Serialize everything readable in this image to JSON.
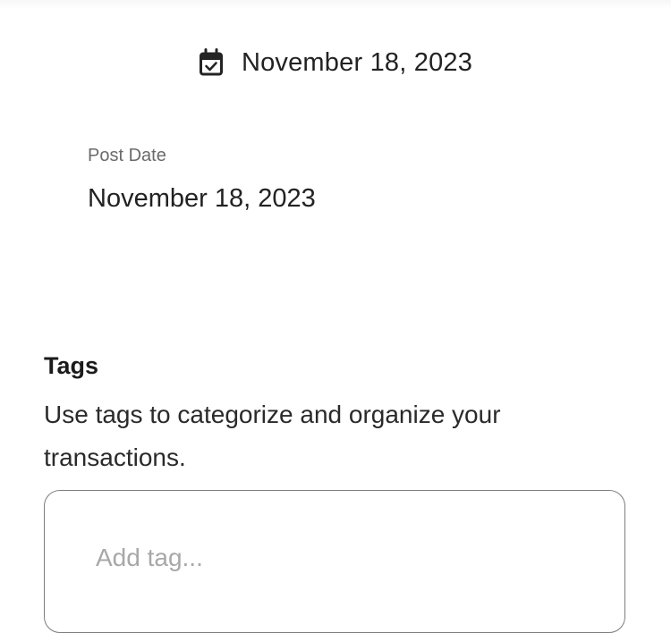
{
  "header": {
    "date": "November 18, 2023",
    "calendar_icon": "calendar-check-icon"
  },
  "post_date": {
    "label": "Post Date",
    "value": "November 18, 2023"
  },
  "tags": {
    "title": "Tags",
    "description": "Use tags to categorize and organize your transactions.",
    "input_placeholder": "Add tag...",
    "input_value": ""
  },
  "colors": {
    "text_primary": "#222222",
    "text_secondary": "#6a6a6a",
    "input_border": "#7d7d7d",
    "placeholder": "#a8a8a8"
  }
}
